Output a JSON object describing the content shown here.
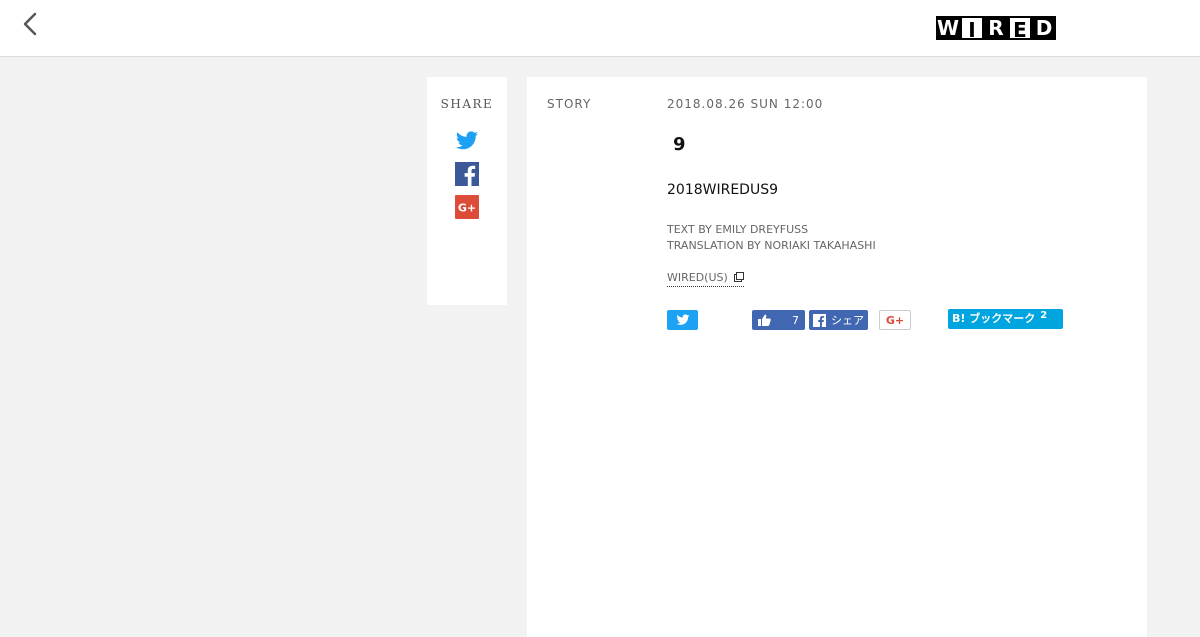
{
  "header": {
    "logo_letters": [
      "W",
      "I",
      "R",
      "E",
      "D"
    ]
  },
  "share": {
    "title": "SHARE",
    "icons": [
      "twitter-icon",
      "facebook-icon",
      "google-plus-icon"
    ]
  },
  "article": {
    "story_label": "STORY",
    "date": "2018.08.26 SUN 12:00",
    "headline": "9",
    "subtitle": "2018WIREDUS9",
    "credits": [
      "TEXT BY EMILY DREYFUSS",
      "TRANSLATION BY NORIAKI TAKAHASHI"
    ],
    "source_link": "WIRED(US)"
  },
  "social_buttons": {
    "like_count": "7",
    "fb_share_label": "シェア",
    "gplus_label": "G+",
    "hatena_label": "B! ブックマーク",
    "hatena_count": "2"
  },
  "colors": {
    "twitter": "#1da1f2",
    "facebook": "#3b5998",
    "google_plus": "#dd4b39",
    "hatena": "#00a4de",
    "background": "#f2f2f2"
  }
}
